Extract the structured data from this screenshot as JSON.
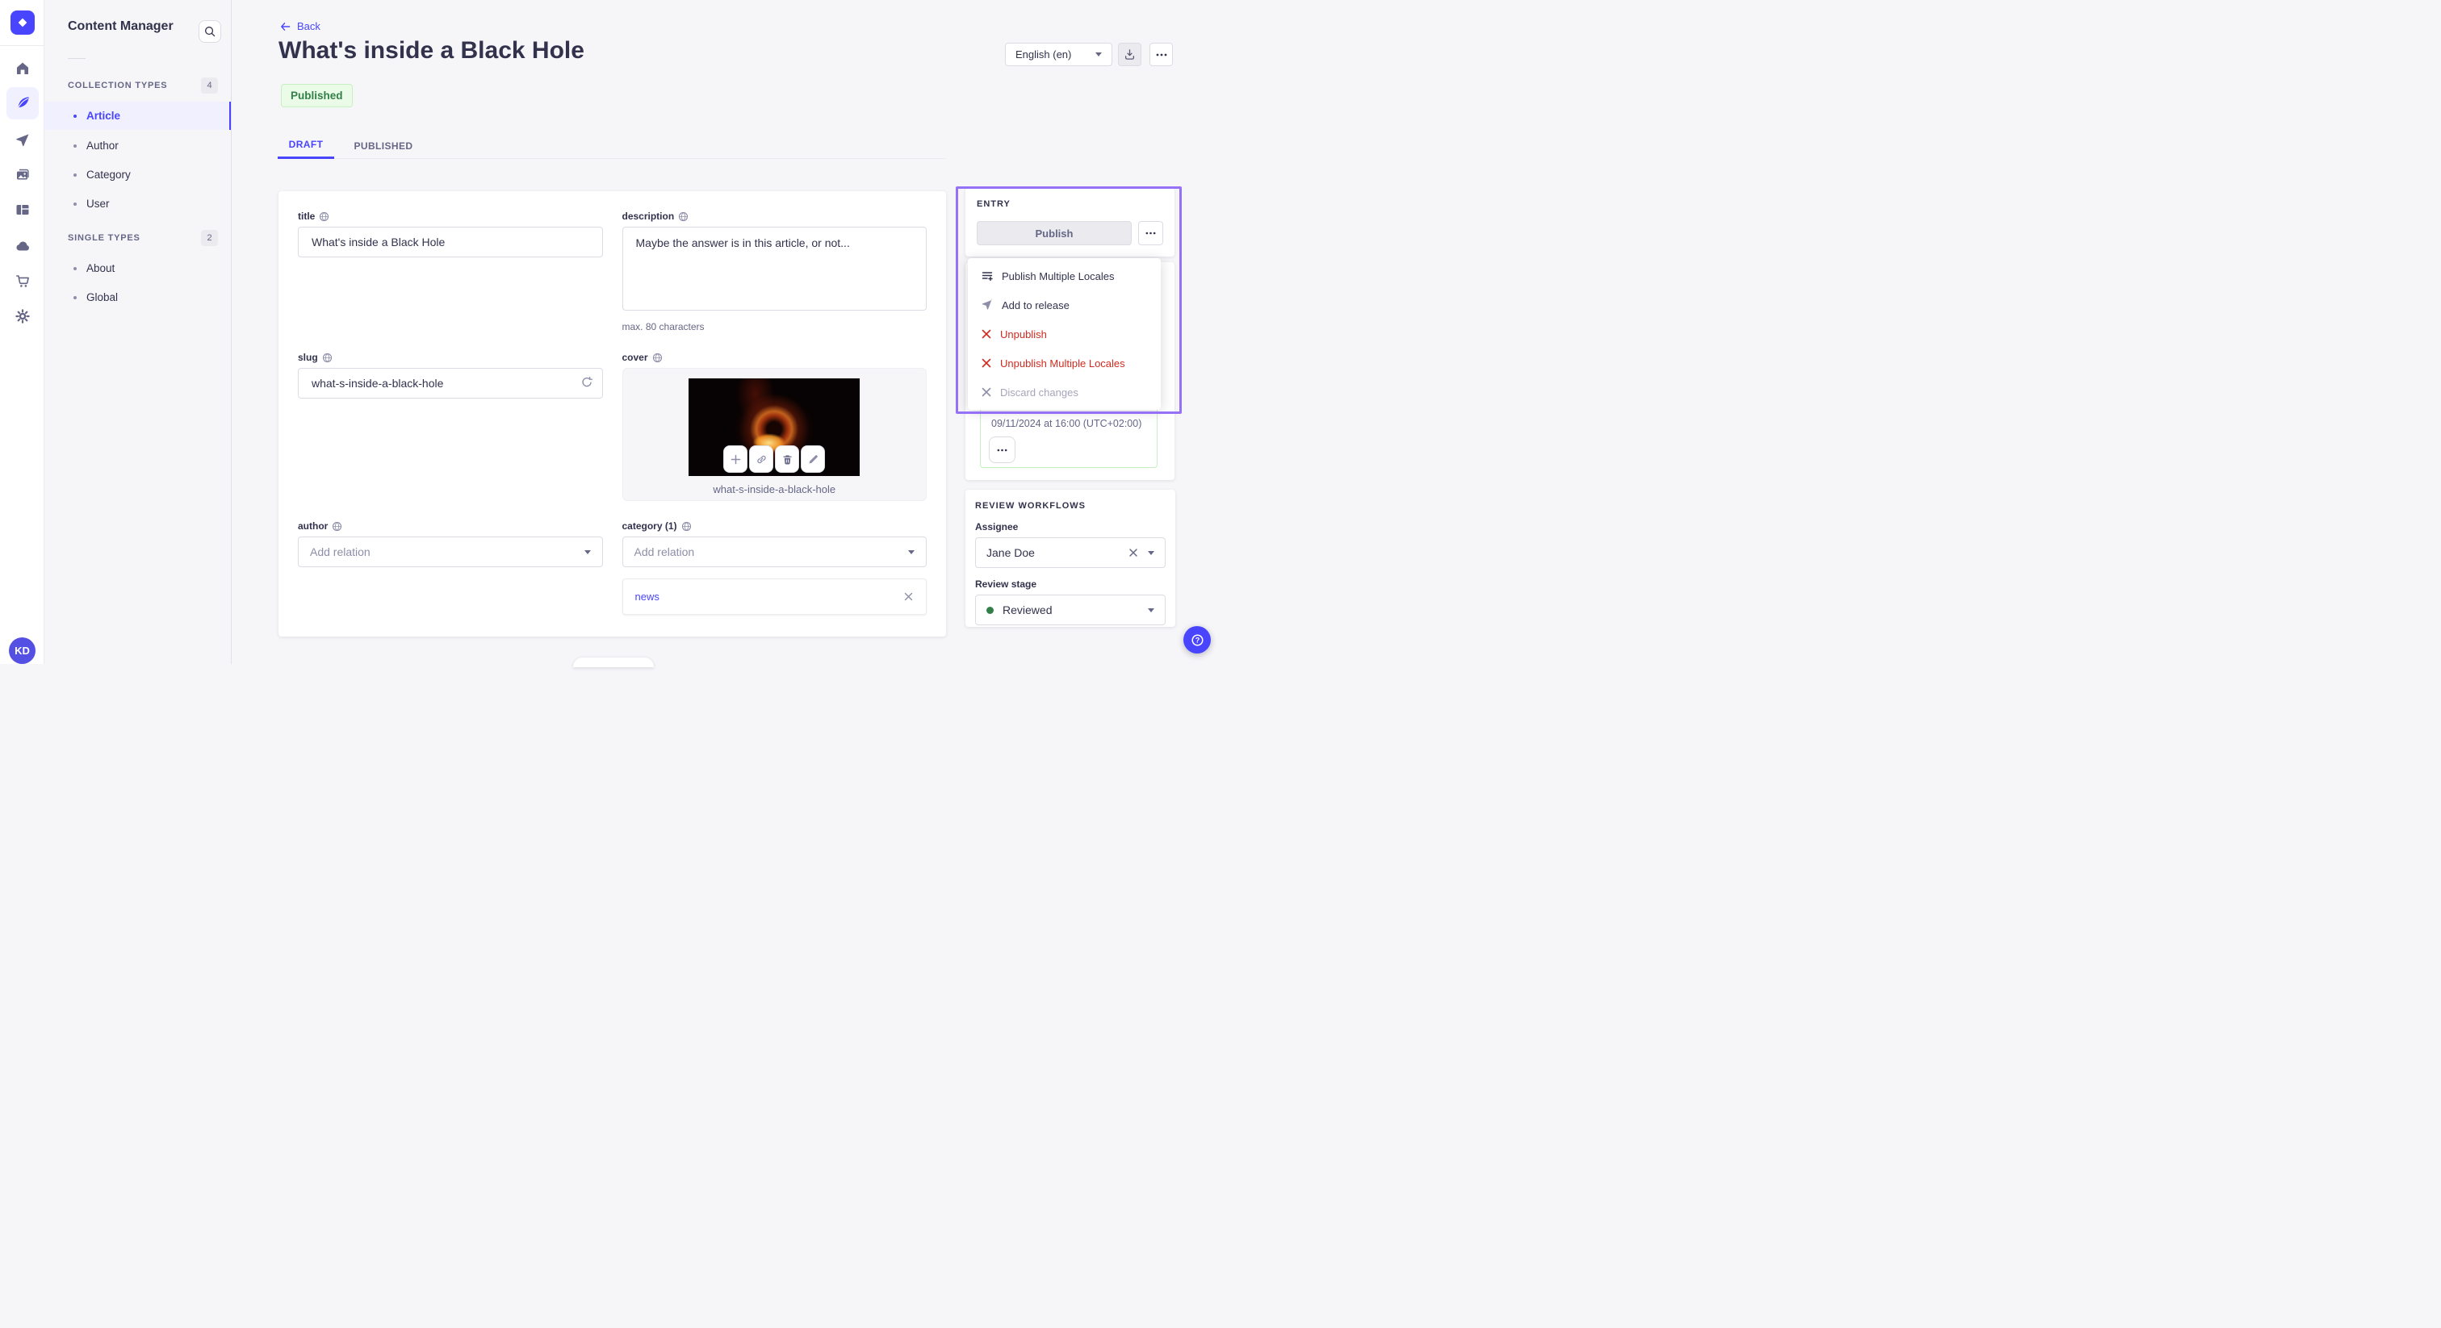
{
  "colors": {
    "accent": "#4945ff",
    "success": "#328048",
    "danger": "#d02b20",
    "highlight_border": "#9571f8",
    "status_bg": "#eafbe7"
  },
  "rail": {
    "avatar_initials": "KD"
  },
  "subnav": {
    "title": "Content Manager",
    "sections": [
      {
        "label": "COLLECTION TYPES",
        "badge": "4",
        "items": [
          {
            "label": "Article"
          },
          {
            "label": "Author"
          },
          {
            "label": "Category"
          },
          {
            "label": "User"
          }
        ]
      },
      {
        "label": "SINGLE TYPES",
        "badge": "2",
        "items": [
          {
            "label": "About"
          },
          {
            "label": "Global"
          }
        ]
      }
    ]
  },
  "header": {
    "back_label": "Back",
    "title": "What's inside a Black Hole",
    "status": "Published",
    "locale": "English (en)"
  },
  "tabs": {
    "draft": "DRAFT",
    "published": "PUBLISHED"
  },
  "form": {
    "title": {
      "label": "title",
      "value": "What's inside a Black Hole"
    },
    "description": {
      "label": "description",
      "value": "Maybe the answer is in this article, or not...",
      "hint": "max. 80 characters"
    },
    "slug": {
      "label": "slug",
      "value": "what-s-inside-a-black-hole"
    },
    "cover": {
      "label": "cover",
      "caption": "what-s-inside-a-black-hole"
    },
    "author": {
      "label": "author",
      "placeholder": "Add relation"
    },
    "category": {
      "label": "category (1)",
      "placeholder": "Add relation",
      "relation": "news"
    }
  },
  "entry": {
    "heading": "ENTRY",
    "publish_label": "Publish",
    "menu": [
      {
        "label": "Publish Multiple Locales",
        "tone": "default",
        "icon": "list-plus-icon"
      },
      {
        "label": "Add to release",
        "tone": "default",
        "icon": "send-icon"
      },
      {
        "label": "Unpublish",
        "tone": "danger",
        "icon": "cross-icon"
      },
      {
        "label": "Unpublish Multiple Locales",
        "tone": "danger",
        "icon": "cross-icon"
      },
      {
        "label": "Discard changes",
        "tone": "disabled",
        "icon": "cross-icon"
      }
    ]
  },
  "release": {
    "scheduled_date": "09/11/2024 at 16:00 (UTC+02:00)"
  },
  "review": {
    "heading": "REVIEW WORKFLOWS",
    "assignee_label": "Assignee",
    "assignee_value": "Jane Doe",
    "stage_label": "Review stage",
    "stage_value": "Reviewed"
  }
}
